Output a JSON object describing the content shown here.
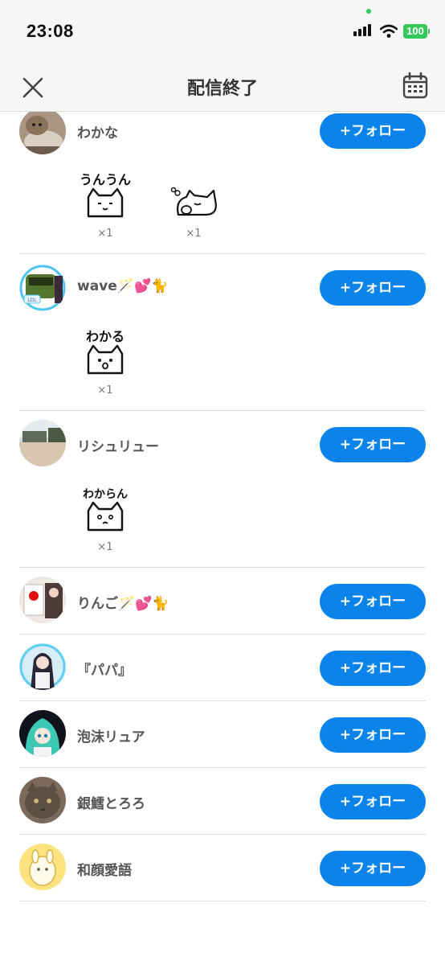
{
  "status_bar": {
    "time": "23:08",
    "battery": "100"
  },
  "header": {
    "title": "配信終了",
    "close_icon": "close-icon",
    "calendar_icon": "calendar-icon"
  },
  "colors": {
    "follow_button": "#0a84ea",
    "battery": "#34c759"
  },
  "follow_label": "+フォロー",
  "users": [
    {
      "name": "わかな",
      "gifts": [
        {
          "text": "うんうん",
          "count": "×1"
        },
        {
          "text": "",
          "count": "×1"
        }
      ]
    },
    {
      "name": "wave🪄💕🐈",
      "gifts": [
        {
          "text": "わかる",
          "count": "×1"
        }
      ]
    },
    {
      "name": "リシュリュー",
      "gifts": [
        {
          "text": "わからん",
          "count": "×1"
        }
      ]
    },
    {
      "name": "りんご🪄💕🐈",
      "gifts": []
    },
    {
      "name": "『パパ』",
      "gifts": []
    },
    {
      "name": "泡沫リュア",
      "gifts": []
    },
    {
      "name": "銀鱈とろろ",
      "gifts": []
    },
    {
      "name": "和顔愛語",
      "gifts": []
    }
  ]
}
